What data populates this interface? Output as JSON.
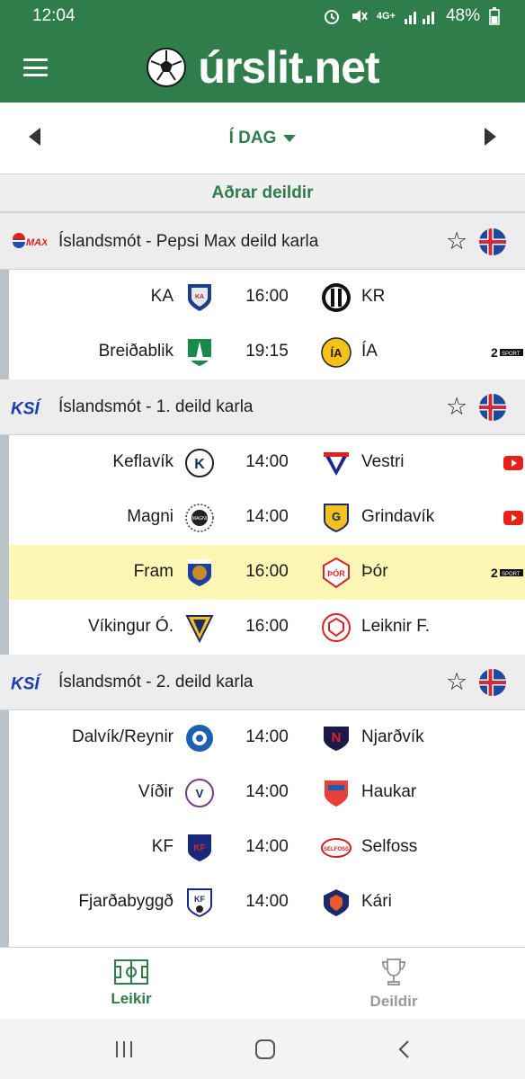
{
  "status": {
    "time": "12:04",
    "battery": "48%",
    "network": "4G+"
  },
  "header": {
    "brand": "úrslit.net"
  },
  "datebar": {
    "label": "Í DAG"
  },
  "other_leagues": "Aðrar deildir",
  "colors": {
    "brand_green": "#2e7d4a",
    "highlight": "#fdf6b4",
    "left_bar": "#b9c3c9"
  },
  "leagues": [
    {
      "logo_text": "PEPSI MAX",
      "name": "Íslandsmót - Pepsi Max deild karla",
      "matches": [
        {
          "home": "KA",
          "time": "16:00",
          "away": "KR",
          "tv": "",
          "highlight": false
        },
        {
          "home": "Breiðablik",
          "time": "19:15",
          "away": "ÍA",
          "tv": "sport",
          "highlight": false
        }
      ]
    },
    {
      "logo_text": "KSÍ",
      "name": "Íslandsmót - 1. deild karla",
      "matches": [
        {
          "home": "Keflavík",
          "time": "14:00",
          "away": "Vestri",
          "tv": "youtube",
          "highlight": false
        },
        {
          "home": "Magni",
          "time": "14:00",
          "away": "Grindavík",
          "tv": "youtube",
          "highlight": false
        },
        {
          "home": "Fram",
          "time": "16:00",
          "away": "Þór",
          "tv": "sport",
          "highlight": true
        },
        {
          "home": "Víkingur Ó.",
          "time": "16:00",
          "away": "Leiknir F.",
          "tv": "",
          "highlight": false
        }
      ]
    },
    {
      "logo_text": "KSÍ",
      "name": "Íslandsmót - 2. deild karla",
      "matches": [
        {
          "home": "Dalvík/Reynir",
          "time": "14:00",
          "away": "Njarðvík",
          "tv": "",
          "highlight": false
        },
        {
          "home": "Víðir",
          "time": "14:00",
          "away": "Haukar",
          "tv": "",
          "highlight": false
        },
        {
          "home": "KF",
          "time": "14:00",
          "away": "Selfoss",
          "tv": "",
          "highlight": false
        },
        {
          "home": "Fjarðabyggð",
          "time": "14:00",
          "away": "Kári",
          "tv": "",
          "highlight": false
        }
      ]
    }
  ],
  "bottom_nav": {
    "games": "Leikir",
    "leagues": "Deildir"
  }
}
